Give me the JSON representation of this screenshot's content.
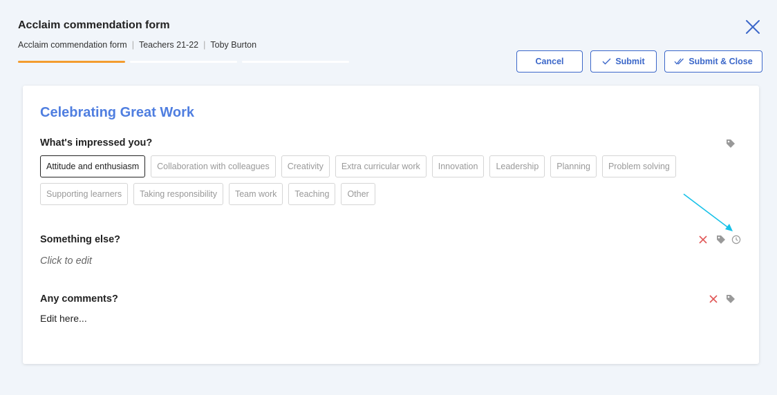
{
  "header": {
    "title": "Acclaim commendation form",
    "breadcrumb": [
      "Acclaim commendation form",
      "Teachers 21-22",
      "Toby Burton"
    ],
    "separator": "|",
    "progress_total": 3,
    "progress_current": 1
  },
  "actions": {
    "cancel_label": "Cancel",
    "submit_label": "Submit",
    "submit_close_label": "Submit & Close"
  },
  "form": {
    "section_title": "Celebrating Great Work",
    "questions": {
      "impressed": {
        "label": "What's impressed you?",
        "chips": [
          "Attitude and enthusiasm",
          "Collaboration with colleagues",
          "Creativity",
          "Extra curricular work",
          "Innovation",
          "Leadership",
          "Planning",
          "Problem solving",
          "Supporting learners",
          "Taking responsibility",
          "Team work",
          "Teaching",
          "Other"
        ],
        "selected": "Attitude and enthusiasm"
      },
      "something_else": {
        "label": "Something else?",
        "placeholder": "Click to edit"
      },
      "comments": {
        "label": "Any comments?",
        "placeholder": "Edit here..."
      }
    }
  },
  "colors": {
    "accent": "#3b67c9",
    "title_blue": "#4f7ee0",
    "progress_active": "#f39c2e",
    "delete_red": "#e05555",
    "annotation_arrow": "#17c1e8"
  }
}
